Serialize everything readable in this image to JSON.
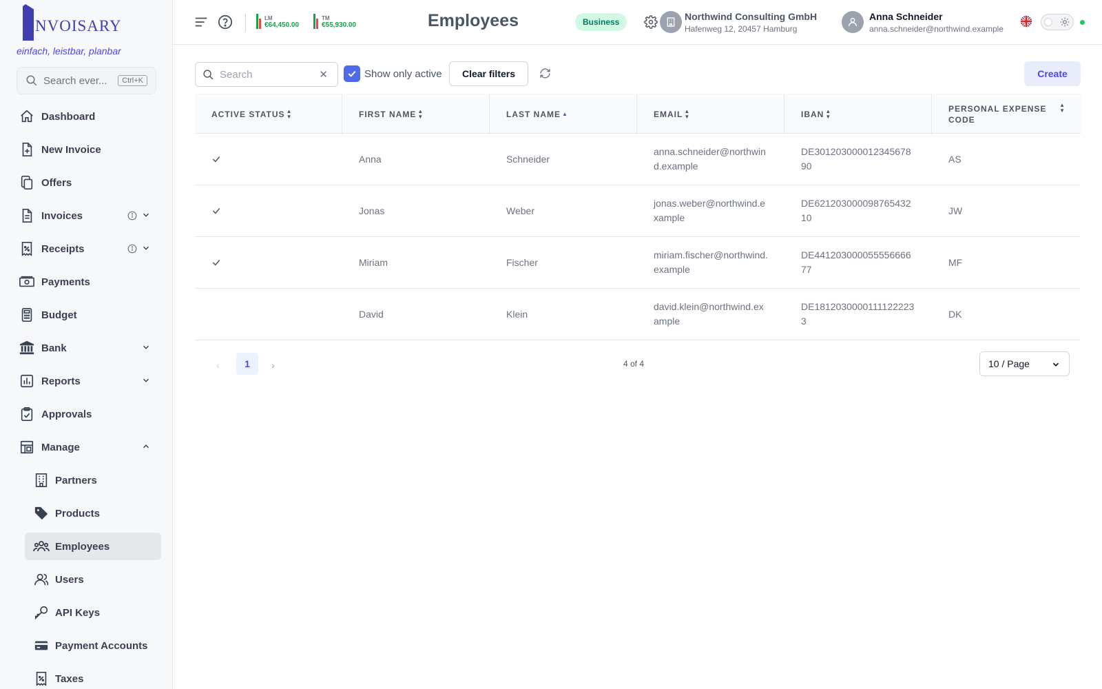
{
  "brand": {
    "logo_text": "NVOISARY",
    "tagline": "einfach, leistbar, planbar"
  },
  "sidebar": {
    "search_placeholder": "Search ever...",
    "search_shortcut": "Ctrl+K",
    "items": [
      {
        "label": "Dashboard",
        "icon": "home-icon"
      },
      {
        "label": "New Invoice",
        "icon": "file-plus-icon"
      },
      {
        "label": "Offers",
        "icon": "copy-icon"
      },
      {
        "label": "Invoices",
        "icon": "file-text-icon",
        "info": true,
        "expandable": true
      },
      {
        "label": "Receipts",
        "icon": "receipt-icon",
        "info": true,
        "expandable": true
      },
      {
        "label": "Payments",
        "icon": "money-icon"
      },
      {
        "label": "Budget",
        "icon": "calculator-icon"
      },
      {
        "label": "Bank",
        "icon": "bank-icon",
        "expandable": true
      },
      {
        "label": "Reports",
        "icon": "chart-icon",
        "expandable": true
      },
      {
        "label": "Approvals",
        "icon": "clipboard-check-icon"
      },
      {
        "label": "Manage",
        "icon": "layout-icon",
        "expanded": true
      }
    ],
    "manage_items": [
      {
        "label": "Partners",
        "icon": "building-icon"
      },
      {
        "label": "Products",
        "icon": "tag-icon"
      },
      {
        "label": "Employees",
        "icon": "users-group-icon",
        "active": true
      },
      {
        "label": "Users",
        "icon": "users-icon"
      },
      {
        "label": "API Keys",
        "icon": "key-icon"
      },
      {
        "label": "Payment Accounts",
        "icon": "credit-card-icon"
      },
      {
        "label": "Taxes",
        "icon": "receipt-percent-icon"
      }
    ]
  },
  "header": {
    "kpi_lm": {
      "label": "LM",
      "value": "€64,450.00"
    },
    "kpi_tm": {
      "label": "TM",
      "value": "€55,930.00"
    },
    "page_title": "Employees",
    "plan_badge": "Business",
    "company_name": "Northwind Consulting GmbH",
    "company_address": "Hafenweg 12, 20457 Hamburg",
    "user_name": "Anna Schneider",
    "user_email": "anna.schneider@northwind.example",
    "colors": {
      "accent": "#4f46e5",
      "success": "#22c55e"
    }
  },
  "toolbar": {
    "search_placeholder": "Search",
    "search_value": "",
    "show_only_active_label": "Show only active",
    "show_only_active_checked": true,
    "clear_filters_label": "Clear filters",
    "create_label": "Create"
  },
  "table": {
    "columns": [
      "ACTIVE STATUS",
      "FIRST NAME",
      "LAST NAME",
      "EMAIL",
      "IBAN",
      "PERSONAL EXPENSE CODE"
    ],
    "sorted_column": "LAST NAME",
    "sort_direction": "ascending",
    "rows": [
      {
        "active": true,
        "first_name": "Anna",
        "last_name": "Schneider",
        "email": "anna.schneider@northwind.example",
        "iban": "DE30120300001234567890",
        "code": "AS"
      },
      {
        "active": true,
        "first_name": "Jonas",
        "last_name": "Weber",
        "email": "jonas.weber@northwind.example",
        "iban": "DE62120300009876543210",
        "code": "JW"
      },
      {
        "active": true,
        "first_name": "Miriam",
        "last_name": "Fischer",
        "email": "miriam.fischer@northwind.example",
        "iban": "DE44120300005555666677",
        "code": "MF"
      },
      {
        "active": false,
        "first_name": "David",
        "last_name": "Klein",
        "email": "david.klein@northwind.example",
        "iban": "DE18120300001111222233",
        "code": "DK"
      }
    ]
  },
  "pagination": {
    "current_page": "1",
    "count_text": "4 of 4",
    "page_size": "10 / Page"
  }
}
